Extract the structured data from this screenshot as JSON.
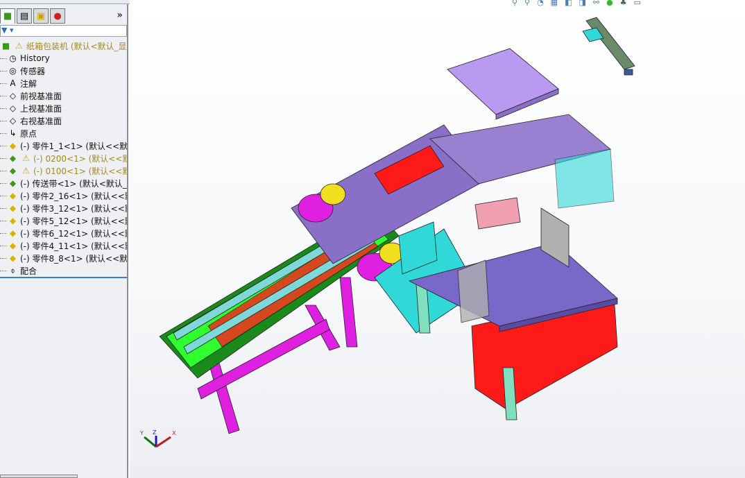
{
  "panel": {
    "tabs": [
      {
        "icon": "feature-manager-icon"
      },
      {
        "icon": "property-manager-icon"
      },
      {
        "icon": "configuration-manager-icon"
      },
      {
        "icon": "display-manager-icon"
      }
    ],
    "more": "»",
    "filter_icon": "filter-icon",
    "tree": [
      {
        "label": "纸箱包装机  (默认<默认_显示",
        "icon": "assembly-icon",
        "warning": true
      },
      {
        "label": "History",
        "icon": "history-icon"
      },
      {
        "label": "传感器",
        "icon": "sensor-icon"
      },
      {
        "label": "注解",
        "icon": "annotation-icon"
      },
      {
        "label": "前视基准面",
        "icon": "plane-icon"
      },
      {
        "label": "上视基准面",
        "icon": "plane-icon"
      },
      {
        "label": "右视基准面",
        "icon": "plane-icon"
      },
      {
        "label": "原点",
        "icon": "origin-icon"
      },
      {
        "label": "(-) 零件1_1<1> (默认<<默认",
        "icon": "part-icon"
      },
      {
        "label": "(-) 0200<1> (默认<<默认",
        "icon": "subassembly-icon",
        "warning": true
      },
      {
        "label": "(-) 0100<1> (默认<<默认",
        "icon": "subassembly-icon",
        "warning": true
      },
      {
        "label": "(-) 传送带<1> (默认<默认_显",
        "icon": "subassembly-icon"
      },
      {
        "label": "(-) 零件2_16<1> (默认<<默",
        "icon": "part-icon"
      },
      {
        "label": "(-) 零件3_12<1> (默认<<默",
        "icon": "part-icon"
      },
      {
        "label": "(-) 零件5_12<1> (默认<<默",
        "icon": "part-icon"
      },
      {
        "label": "(-) 零件6_12<1> (默认<<默",
        "icon": "part-icon"
      },
      {
        "label": "(-) 零件4_11<1> (默认<<默",
        "icon": "part-icon"
      },
      {
        "label": "(-) 零件8_8<1> (默认<<默认",
        "icon": "part-icon"
      },
      {
        "label": "配合",
        "icon": "mates-icon"
      }
    ]
  },
  "viewport": {
    "triad": {
      "x": "X",
      "y": "Y",
      "z": "Z"
    },
    "colors": {
      "magenta": "#e020e0",
      "purple": "#8a6fc8",
      "lavender": "#b99af0",
      "red": "#ff1a1a",
      "cyan": "#30d8d8",
      "green": "#30ff30",
      "yellow": "#f0e020"
    }
  }
}
